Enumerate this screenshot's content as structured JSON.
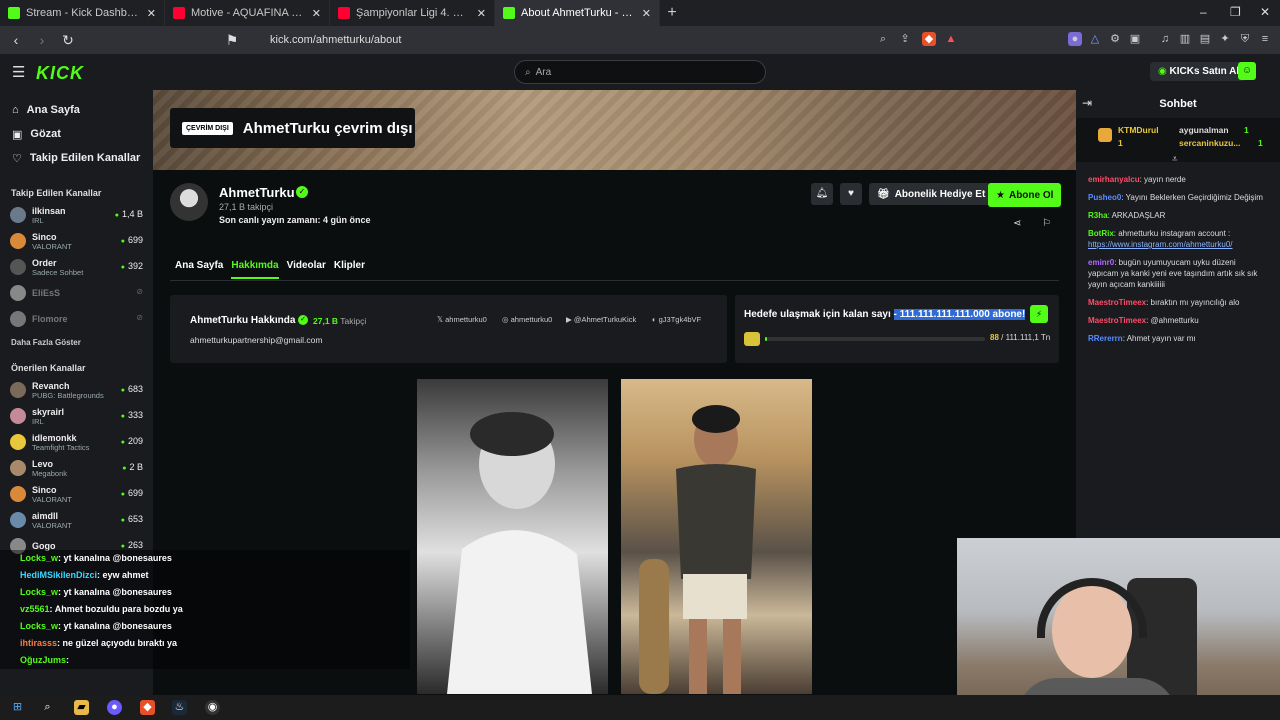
{
  "browser": {
    "tabs": [
      {
        "title": "Stream - Kick Dashboard",
        "color": "#53fc18"
      },
      {
        "title": "Motive - AQUAFINA (Official Music V",
        "color": "#ff0033"
      },
      {
        "title": "Şampiyonlar Ligi 4. Hafta | Ajax - Gal",
        "color": "#ff0033"
      },
      {
        "title": "About AhmetTurku - Watch Live",
        "color": "#53fc18"
      }
    ],
    "url": "kick.com/ahmetturku/about"
  },
  "header": {
    "logo": "KICK",
    "search_placeholder": "Ara",
    "kicks_label": "KICKs Satın Al"
  },
  "sidebar": {
    "nav": [
      "Ana Sayfa",
      "Gözat",
      "Takip Edilen Kanallar"
    ],
    "followed_title": "Takip Edilen Kanallar",
    "followed": [
      {
        "name": "ilkinsan",
        "cat": "IRL",
        "viewers": "1,4 B",
        "color": "#6b7a8a"
      },
      {
        "name": "Sinco",
        "cat": "VALORANT",
        "viewers": "699",
        "color": "#d88a3a"
      },
      {
        "name": "Order",
        "cat": "Sadece Sohbet",
        "viewers": "392",
        "color": "#555"
      },
      {
        "name": "EliEsS",
        "cat": "",
        "viewers": "",
        "color": "#888"
      },
      {
        "name": "Flomore",
        "cat": "",
        "viewers": "",
        "color": "#777"
      }
    ],
    "show_more": "Daha Fazla Göster",
    "recommended_title": "Önerilen Kanallar",
    "recommended": [
      {
        "name": "Revanch",
        "cat": "PUBG: Battlegrounds",
        "viewers": "683",
        "color": "#7a6a5a"
      },
      {
        "name": "skyrairl",
        "cat": "IRL",
        "viewers": "333",
        "color": "#c58a9a"
      },
      {
        "name": "idlemonkk",
        "cat": "Teamfight Tactics",
        "viewers": "209",
        "color": "#e8c83a"
      },
      {
        "name": "Levo",
        "cat": "Megabonk",
        "viewers": "2 B",
        "color": "#a88a6a"
      },
      {
        "name": "Sinco",
        "cat": "VALORANT",
        "viewers": "699",
        "color": "#d88a3a"
      },
      {
        "name": "aimdll",
        "cat": "VALORANT",
        "viewers": "653",
        "color": "#6a8aaa"
      },
      {
        "name": "Gogo",
        "cat": "",
        "viewers": "263",
        "color": "#888"
      }
    ]
  },
  "channel": {
    "offline_badge": "ÇEVRİM DIŞI",
    "offline_title": "AhmetTurku çevrim dışı",
    "name": "AhmetTurku",
    "followers": "27,1 B takipçi",
    "last_live": "Son canlı yayın zamanı: 4 gün önce",
    "gift_label": "Abonelik Hediye Et",
    "sub_label": "Abone Ol",
    "tabs": [
      "Ana Sayfa",
      "Hakkımda",
      "Videolar",
      "Klipler"
    ],
    "active_tab": "Hakkımda"
  },
  "about": {
    "title": "AhmetTurku Hakkında",
    "followers_count": "27,1 B",
    "followers_label": "Takipçi",
    "email": "ahmetturkupartnership@gmail.com",
    "socials": [
      "ahmetturku0",
      "ahmetturku0",
      "@AhmetTurkuKick",
      "gJ3Tgk4bVF"
    ]
  },
  "goal": {
    "prefix": "Hedefe ulaşmak için kalan sayı",
    "highlight": "- 111.111.111.111.000 abone!",
    "current": "88",
    "total": "/ 111.111,1 Tn",
    "progress_percent": 1
  },
  "overlay_chat": [
    {
      "user": "Locks_w",
      "msg": ": yt kanalına @bonesaures",
      "cls": "u"
    },
    {
      "user": "HediMSikilenDizci",
      "msg": ": eyw ahmet",
      "cls": "u4"
    },
    {
      "user": "Locks_w",
      "msg": ": yt kanalına @bonesaures",
      "cls": "u"
    },
    {
      "user": "vz5561",
      "msg": ": Ahmet bozuldu para bozdu ya",
      "cls": "u"
    },
    {
      "user": "Locks_w",
      "msg": ": yt kanalına @bonesaures",
      "cls": "u"
    },
    {
      "user": "ihtirasss",
      "msg": ": ne güzel açıyodu bıraktı ya",
      "cls": "u3"
    },
    {
      "user": "OğuzJums",
      "msg": ":",
      "cls": "u"
    }
  ],
  "chat": {
    "title": "Sohbet",
    "pinned": [
      {
        "name": "KTMDurul",
        "count": "1"
      },
      {
        "name": "aygunalman",
        "count": "1"
      },
      {
        "name": "sercaninkuzu...",
        "count": "1"
      }
    ],
    "messages": [
      {
        "user": "emirhanyalcu",
        "color": "#ff4d6a",
        "text": ": yayın nerde"
      },
      {
        "user": "Pusheo0",
        "color": "#5b8cff",
        "text": ": Yayını Beklerken Geçirdiğimiz Değişim"
      },
      {
        "user": "R3ha",
        "color": "#53fc18",
        "text": ": ARKADAŞLAR"
      },
      {
        "user": "BotRix",
        "color": "#53fc18",
        "text": ": ahmetturku instagram account :",
        "link": "https://www.instagram.com/ahmetturku0/"
      },
      {
        "user": "eminr0",
        "color": "#b06bff",
        "text": ": bugün uyumuyucam uyku düzeni yapıcam ya kanki yeni eve taşındım artık sık sık yayın açıcam kankiiiiii"
      },
      {
        "user": "MaestroTimeex",
        "color": "#ff4d6a",
        "text": ": bıraktın mı yayıncılığı alo"
      },
      {
        "user": "MaestroTimeex",
        "color": "#ff4d6a",
        "text": ": @ahmetturku"
      },
      {
        "user": "RRererrn",
        "color": "#5b8cff",
        "text": ": Ahmet yayın var mı"
      }
    ]
  }
}
